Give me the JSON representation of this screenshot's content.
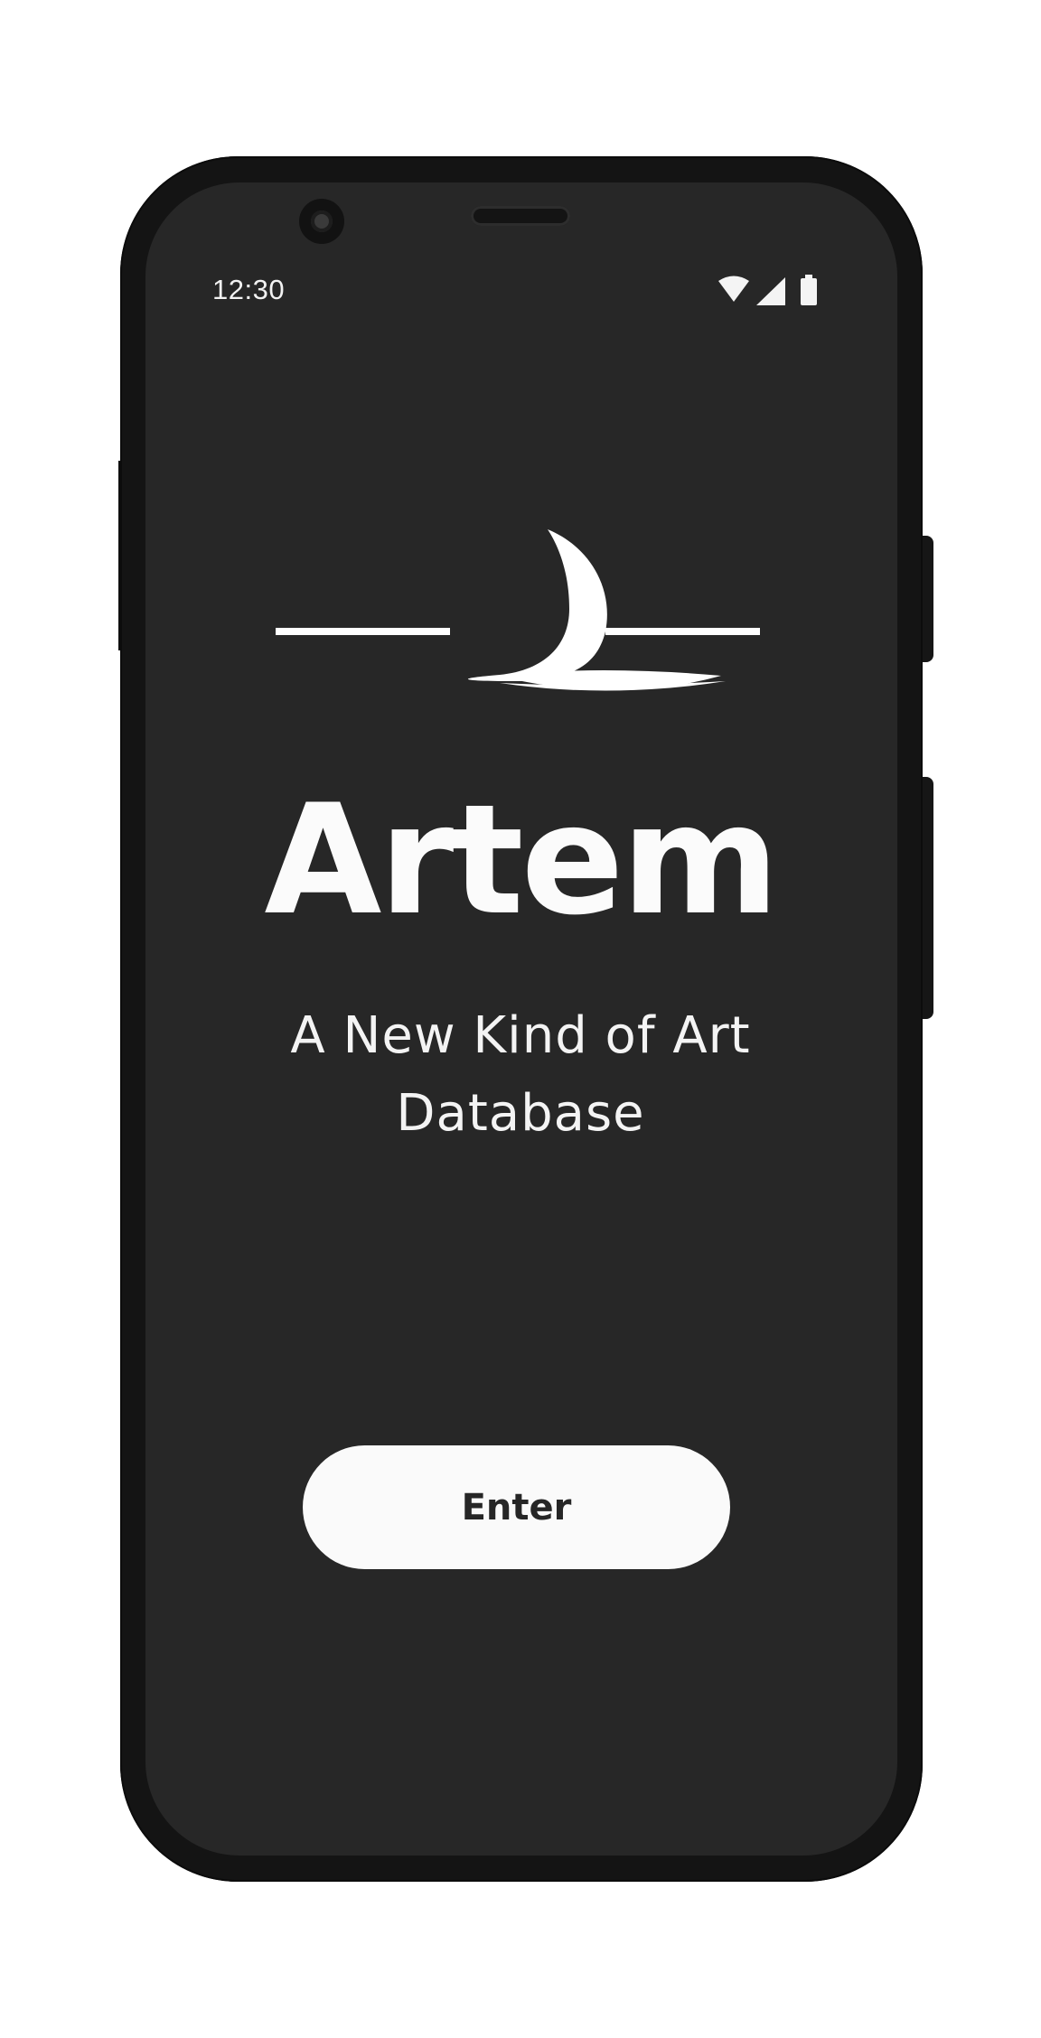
{
  "status_bar": {
    "time": "12:30",
    "icons": [
      "wifi-icon",
      "cellular-signal-icon",
      "battery-icon"
    ]
  },
  "app": {
    "logo": "moon-horizon-logo",
    "title": "Artem",
    "tagline_line1": "A New Kind of Art",
    "tagline_line2": "Database",
    "enter_label": "Enter"
  },
  "colors": {
    "screen_background": "#272727",
    "phone_frame": "#141414",
    "text_primary": "#fbfbfb",
    "button_background": "#fafafa",
    "button_text": "#262626"
  }
}
